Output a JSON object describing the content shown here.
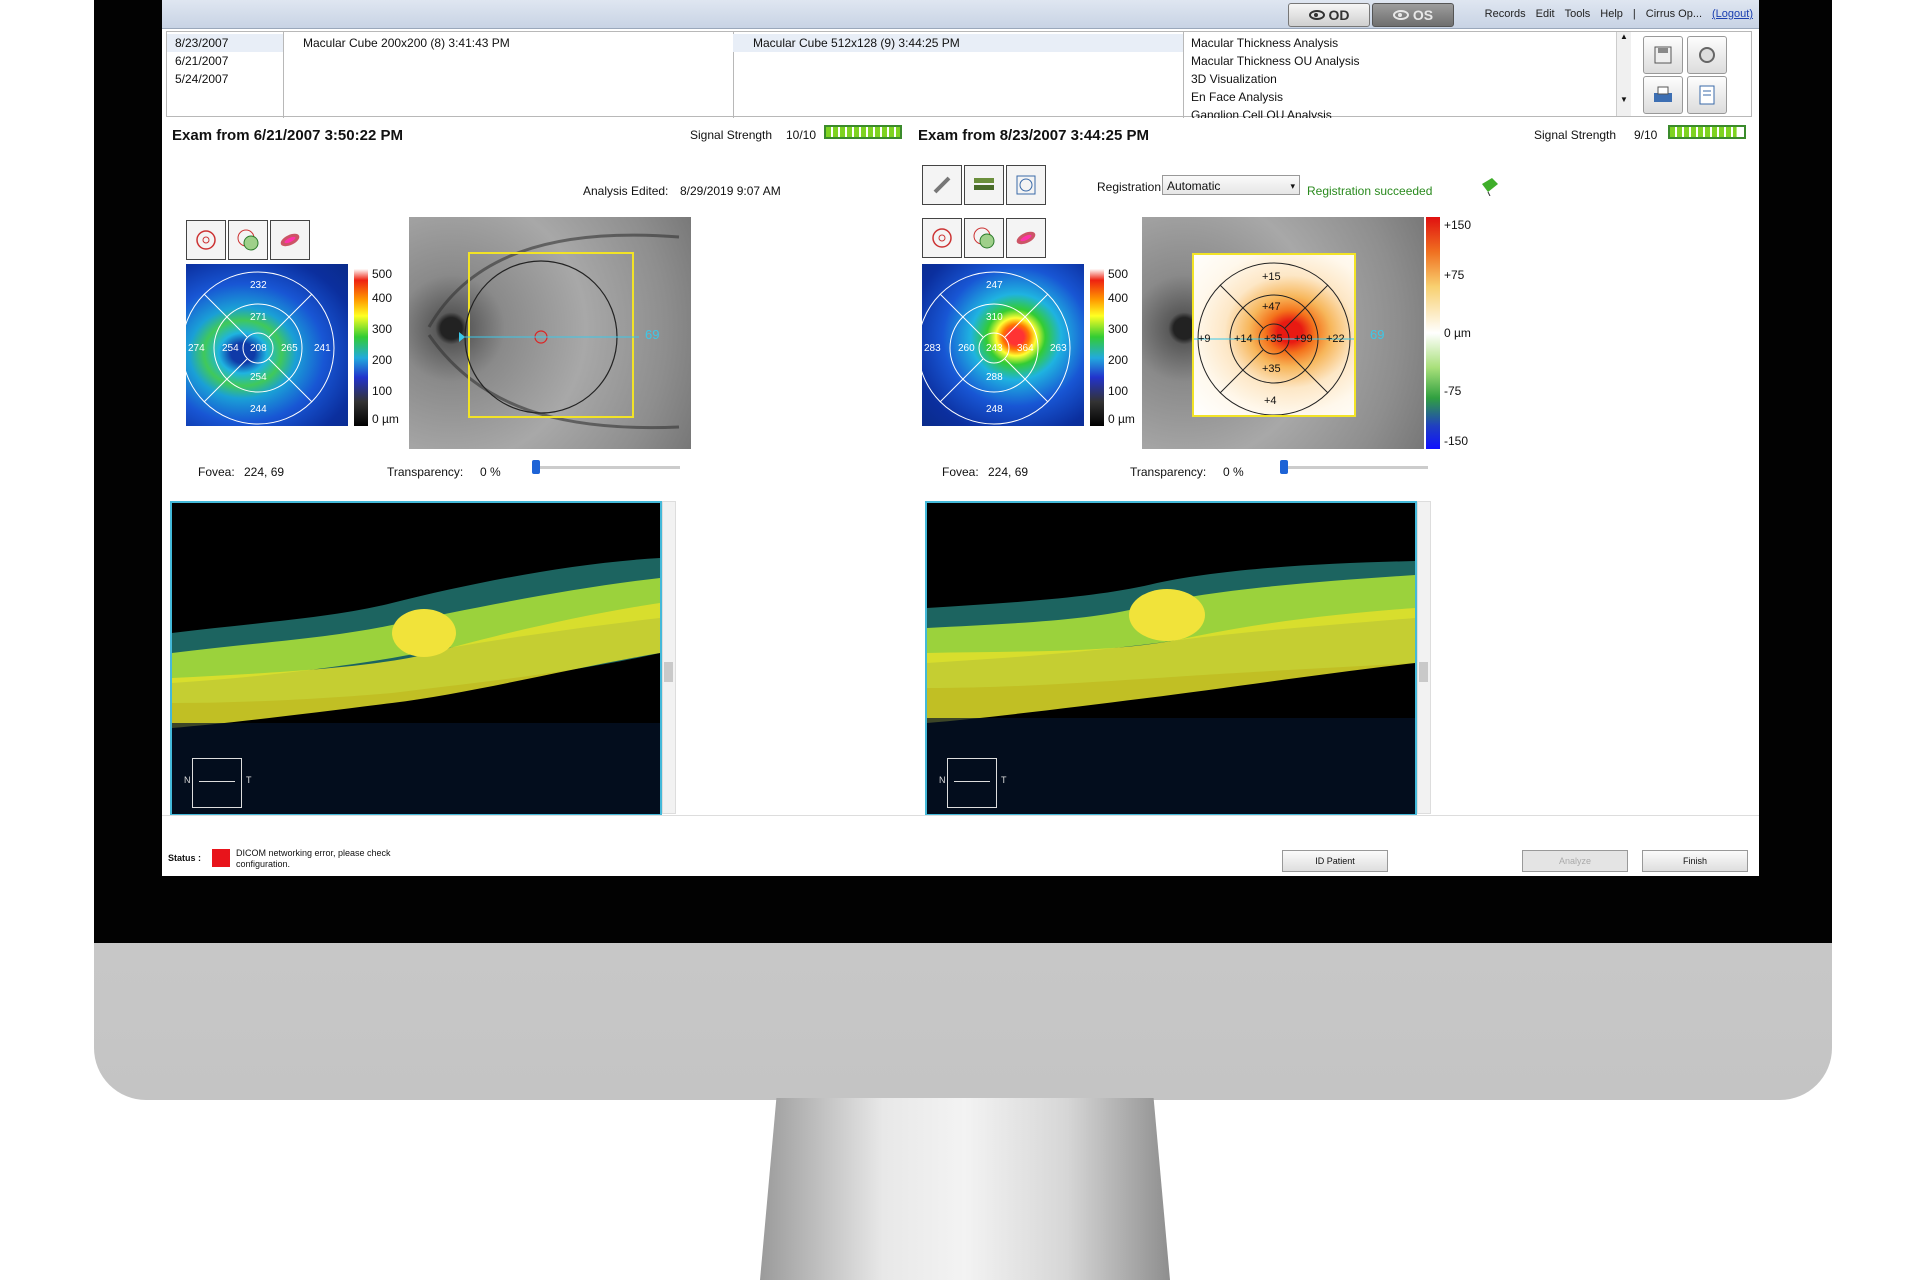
{
  "topbar": {
    "od_label": "OD",
    "os_label": "OS",
    "menu": [
      "Records",
      "Edit",
      "Tools",
      "Help",
      "|",
      "Cirrus Op..."
    ],
    "logout": "(Logout)"
  },
  "header": {
    "dates": [
      "8/23/2007",
      "6/21/2007",
      "5/24/2007"
    ],
    "scan_left": "Macular Cube 200x200 (8) 3:41:43 PM",
    "scan_right": "Macular Cube 512x128 (9) 3:44:25 PM",
    "analyses": [
      "Macular Thickness Analysis",
      "Macular Thickness OU Analysis",
      "3D Visualization",
      "En Face Analysis",
      "Ganglion Cell OU Analysis"
    ]
  },
  "left": {
    "title": "Exam from 6/21/2007 3:50:22 PM",
    "signal_label": "Signal Strength",
    "signal_value": "10/10",
    "signal_level": 1.0,
    "analysis_edited_label": "Analysis Edited:",
    "analysis_edited_value": "8/29/2019 9:07 AM",
    "sector_values": {
      "top": "232",
      "inner_top": "271",
      "outer_left": "274",
      "inner_left": "254",
      "center": "208",
      "inner_right": "265",
      "outer_right": "241",
      "inner_bottom": "254",
      "bottom": "244"
    },
    "scale_ticks": [
      "500",
      "400",
      "300",
      "200",
      "100",
      "0 µm"
    ],
    "fovea_label": "Fovea:",
    "fovea_value": "224, 69",
    "transparency_label": "Transparency:",
    "transparency_value": "0 %",
    "transparency_level": 0,
    "line_label": "69"
  },
  "right": {
    "title": "Exam from 8/23/2007 3:44:25 PM",
    "signal_label": "Signal Strength",
    "signal_value": "9/10",
    "signal_level": 0.9,
    "registration_label": "Registration:",
    "registration_value": "Automatic",
    "registration_status": "Registration succeeded",
    "sector_values": {
      "top": "247",
      "inner_top": "310",
      "outer_left": "283",
      "inner_left": "260",
      "center": "243",
      "inner_right": "364",
      "outer_right": "263",
      "inner_bottom": "288",
      "bottom": "248"
    },
    "scale_ticks": [
      "500",
      "400",
      "300",
      "200",
      "100",
      "0 µm"
    ],
    "change_values": {
      "top": "+15",
      "inner_top": "+47",
      "outer_left": "+9",
      "inner_left": "+14",
      "center": "+35",
      "inner_right": "+99",
      "outer_right": "+22",
      "inner_bottom": "+35",
      "bottom": "+4"
    },
    "change_ticks": [
      "+150",
      "+75",
      "0 µm",
      "-75",
      "-150"
    ],
    "fovea_label": "Fovea:",
    "fovea_value": "224, 69",
    "transparency_label": "Transparency:",
    "transparency_value": "0 %",
    "transparency_level": 0,
    "line_label": "69"
  },
  "oct": {
    "n_label": "N",
    "t_label": "T"
  },
  "footer": {
    "status_label": "Status :",
    "status_message_1": "DICOM networking error, please check",
    "status_message_2": "configuration.",
    "id_patient": "ID Patient",
    "analyze": "Analyze",
    "finish": "Finish"
  },
  "colors": {
    "accent": "#44b9d9",
    "status_error": "#e8141b",
    "registration_ok": "#2a8a1e",
    "signal": "#7ed321"
  }
}
